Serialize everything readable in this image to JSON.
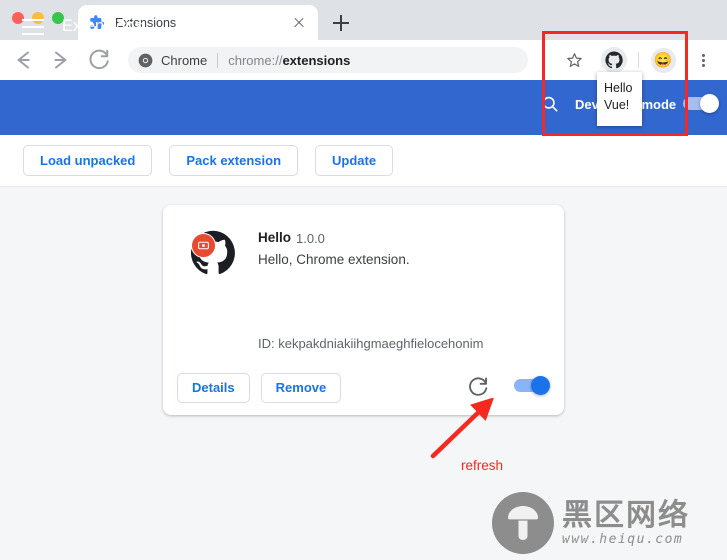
{
  "window": {
    "traffic_lights": [
      "close",
      "minimize",
      "maximize"
    ]
  },
  "tabstrip": {
    "tab": {
      "title": "Extensions",
      "favicon": "puzzle-piece-icon",
      "close": "close-icon"
    },
    "new_tab": "plus-icon"
  },
  "toolbar": {
    "back": "back-arrow-icon",
    "forward": "forward-arrow-icon",
    "reload": "reload-icon",
    "omnibox": {
      "site_icon": "chrome-logo-icon",
      "site_label": "Chrome",
      "url_prefix": "chrome://",
      "url_bold": "extensions"
    },
    "bookmark": "star-icon",
    "github_extension": "github-icon",
    "profile_avatar": "😄",
    "menu": "kebab-menu-icon"
  },
  "app_header": {
    "menu_icon": "hamburger-icon",
    "title": "Extensions",
    "search_icon": "search-icon",
    "developer_mode_label": "Developer mode",
    "developer_mode_on": true
  },
  "action_bar": {
    "buttons": [
      {
        "label": "Load unpacked"
      },
      {
        "label": "Pack extension"
      },
      {
        "label": "Update"
      }
    ]
  },
  "extension_card": {
    "icon": "github-octocat-icon",
    "badge_icon": "media-badge-icon",
    "name": "Hello",
    "version": "1.0.0",
    "description": "Hello, Chrome extension.",
    "id_label": "ID: kekpakdniakiihgmaeghfielocehonim",
    "details_label": "Details",
    "remove_label": "Remove",
    "refresh_icon": "refresh-icon",
    "enabled": true
  },
  "annotations": {
    "highlight_box_color": "#f5291f",
    "tooltip": {
      "line1": "Hello",
      "line2": "Vue!"
    },
    "arrow_color": "#f5291f",
    "refresh_note": "refresh"
  },
  "watermark": {
    "logo": "mushroom-logo-icon",
    "name_cn": "黑区网络",
    "url": "www.heiqu.com"
  }
}
